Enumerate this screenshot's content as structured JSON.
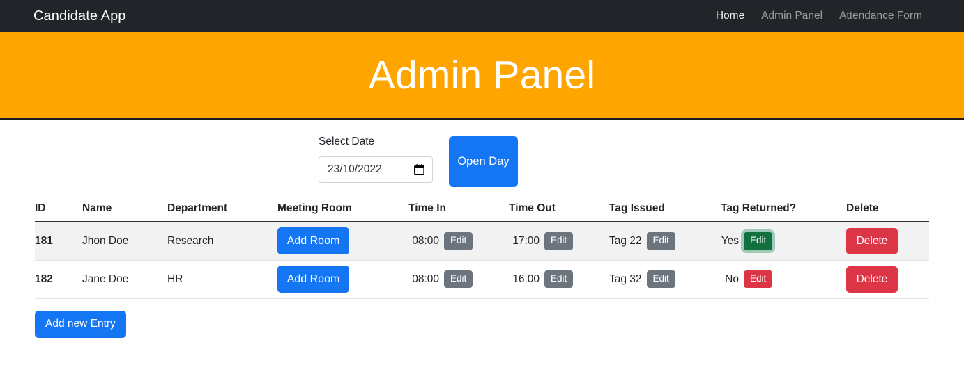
{
  "navbar": {
    "brand": "Candidate App",
    "links": [
      {
        "label": "Home",
        "active": true
      },
      {
        "label": "Admin Panel",
        "active": false
      },
      {
        "label": "Attendance Form",
        "active": false
      }
    ]
  },
  "banner": {
    "title": "Admin Panel",
    "background_color": "#ffa500"
  },
  "controls": {
    "date_label": "Select Date",
    "date_value": "23/10/2022",
    "date_icon": "calendar-icon",
    "open_day_label": "Open Day",
    "open_day_color": "#1476f2"
  },
  "table": {
    "headers": [
      "ID",
      "Name",
      "Department",
      "Meeting Room",
      "Time In",
      "Time Out",
      "Tag Issued",
      "Tag Returned?",
      "Delete"
    ],
    "edit_label": "Edit",
    "add_room_label": "Add Room",
    "delete_label": "Delete",
    "rows": [
      {
        "id": "181",
        "name": "Jhon Doe",
        "department": "Research",
        "meeting_room": "Add Room",
        "time_in": "08:00",
        "time_out": "17:00",
        "tag_issued": "Tag 22",
        "tag_returned": "Yes",
        "tag_returned_state": "yes",
        "delete": "Delete"
      },
      {
        "id": "182",
        "name": "Jane Doe",
        "department": "HR",
        "meeting_room": "Add Room",
        "time_in": "08:00",
        "time_out": "16:00",
        "tag_issued": "Tag 32",
        "tag_returned": "No",
        "tag_returned_state": "no",
        "delete": "Delete"
      }
    ]
  },
  "footer": {
    "add_entry_label": "Add new Entry"
  },
  "colors": {
    "primary_blue": "#1476f2",
    "danger_red": "#dc3545",
    "secondary_gray": "#6c757d",
    "success_green": "#13713f",
    "navbar_dark": "#212529",
    "banner_orange": "#ffa500"
  }
}
